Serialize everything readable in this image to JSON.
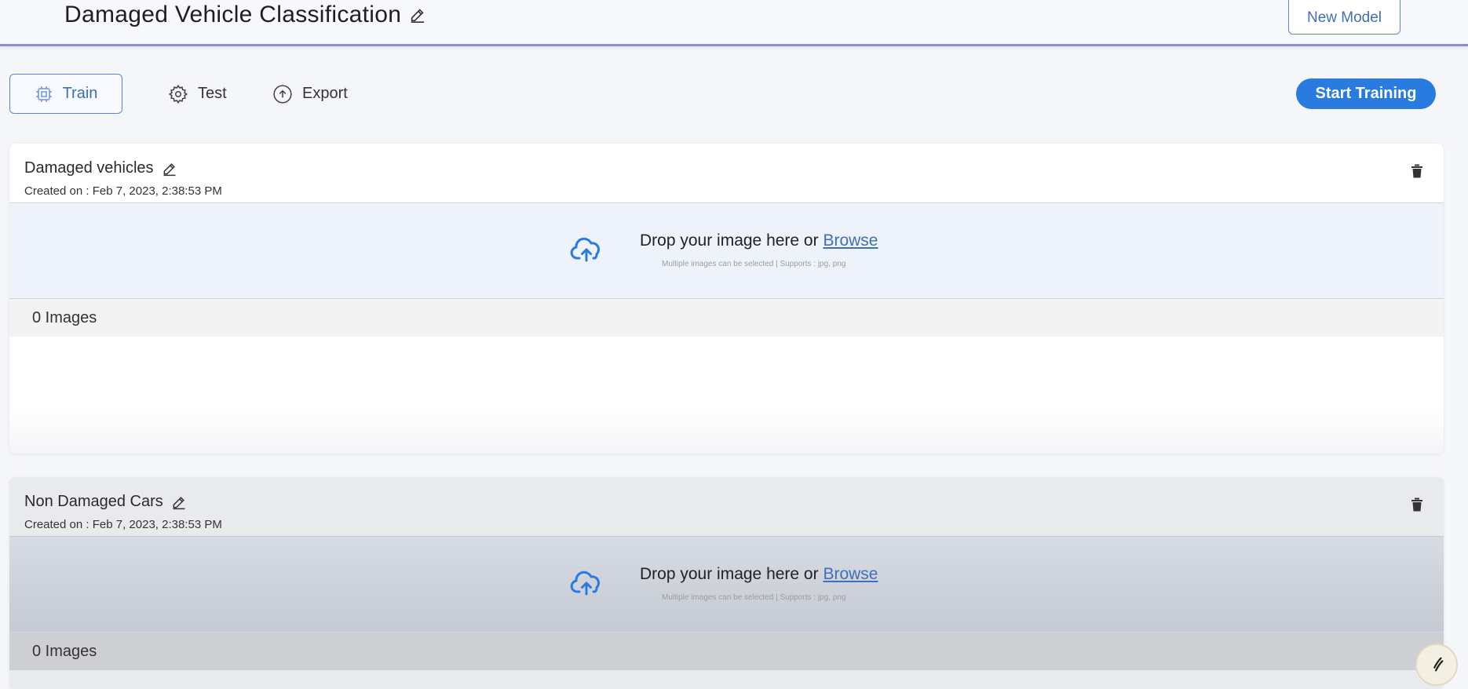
{
  "header": {
    "title": "Damaged Vehicle Classification",
    "new_model_label": "New Model"
  },
  "tabs": [
    {
      "label": "Train",
      "icon": "chip-icon",
      "active": true
    },
    {
      "label": "Test",
      "icon": "gear-icon",
      "active": false
    },
    {
      "label": "Export",
      "icon": "upload-icon",
      "active": false
    }
  ],
  "actions": {
    "start_training_label": "Start Training"
  },
  "classes": [
    {
      "name": "Damaged vehicles",
      "created": "Created on : Feb 7, 2023, 2:38:53 PM",
      "drop_text": "Drop your image here or",
      "browse_label": "Browse",
      "hint": "Multiple images can be selected | Supports : jpg, png",
      "image_count": "0 Images"
    },
    {
      "name": "Non Damaged Cars",
      "created": "Created on : Feb 7, 2023, 2:38:53 PM",
      "drop_text": "Drop your image here or",
      "browse_label": "Browse",
      "hint": "Multiple images can be selected | Supports : jpg, png",
      "image_count": "0 Images"
    }
  ],
  "colors": {
    "accent": "#2a7be0",
    "link": "#3f6fb6",
    "header_border": "#8f8fc6"
  }
}
